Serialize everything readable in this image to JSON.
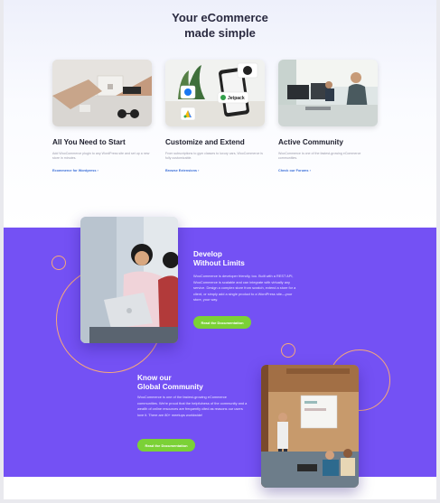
{
  "hero": {
    "title_line1": "Your eCommerce",
    "title_line2": "made simple"
  },
  "cards": [
    {
      "title": "All You Need to Start",
      "text": "Add WooCommerce plugin to any WordPress site and set up a new store in minutes.",
      "link": "Ecommerce for Wordpress ›"
    },
    {
      "title": "Customize and Extend",
      "text": "From subscriptions to gym classes to luxury cars, WooCommerce is fully customizable.",
      "link": "Browse Extensions ›"
    },
    {
      "title": "Active Community",
      "text": "WooCommerce is one of the fastest-growing eCommerce communities.",
      "link": "Check our Forums ›"
    }
  ],
  "develop": {
    "title_line1": "Develop",
    "title_line2": "Without Limits",
    "text": "WooCommerce is developer friendly, too. Built with a REST API, WooCommerce is scalable and can integrate with virtually any service. Design a complex store from scratch, extend a store for a client, or simply add a single product to a WordPress site—your store, your way.",
    "button": "Read the Documentation"
  },
  "community": {
    "title_line1": "Know our",
    "title_line2": "Global Community",
    "text": "WooCommerce is one of the fastest-growing eCommerce communities. We're proud that the helpfulness of the community and a wealth of online resources are frequently cited as reasons our users love it. There are 80+ meetups worldwide!",
    "button": "Read the Documentation"
  },
  "colors": {
    "purple": "#7451f4",
    "button_green": "#7bd136",
    "ring_orange": "#f7a97a",
    "link_blue": "#3b6fd8"
  },
  "icons": [
    "facebook-icon",
    "google-ads-icon",
    "mailchimp-icon",
    "jetpack-icon"
  ],
  "card2_badge": "Jetpack"
}
